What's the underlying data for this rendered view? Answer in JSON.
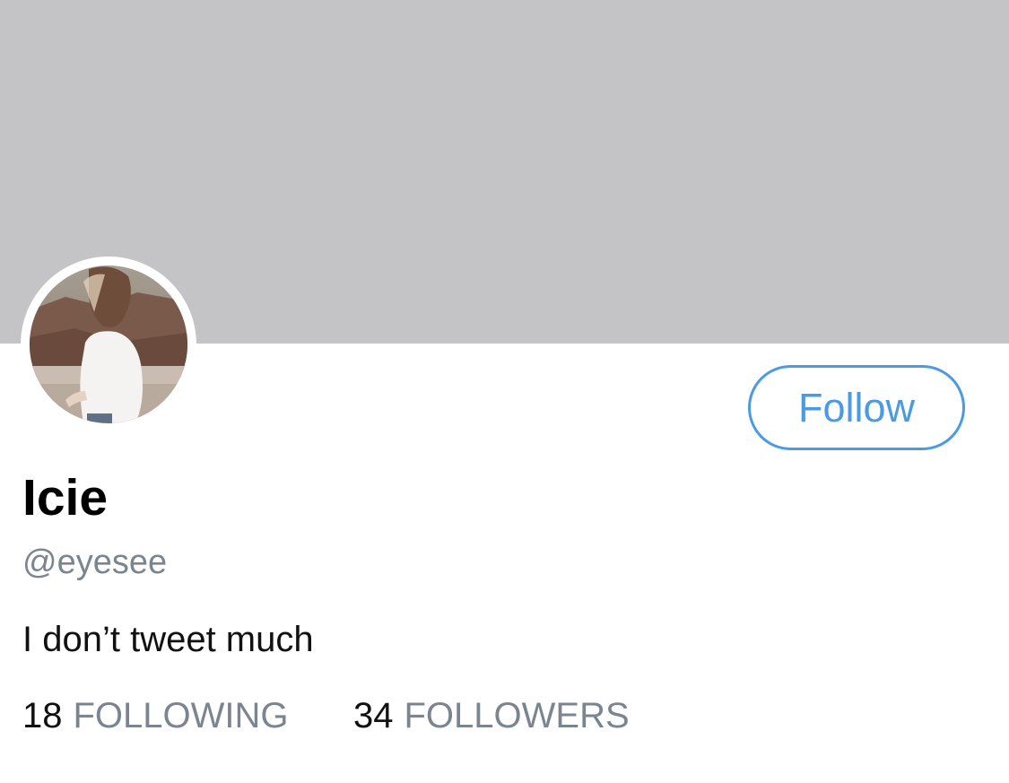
{
  "profile": {
    "display_name": "Icie",
    "handle": "@eyesee",
    "bio": "I don’t tweet much",
    "follow_label": "Follow",
    "avatar_icon": "profile-photo"
  },
  "stats": {
    "following_count": "18",
    "following_label": "FOLLOWING",
    "followers_count": "34",
    "followers_label": "FOLLOWERS"
  },
  "colors": {
    "banner": "#c4c4c6",
    "accent": "#4a9ae4",
    "secondary_text": "#7b8590",
    "primary_text": "#111111"
  }
}
